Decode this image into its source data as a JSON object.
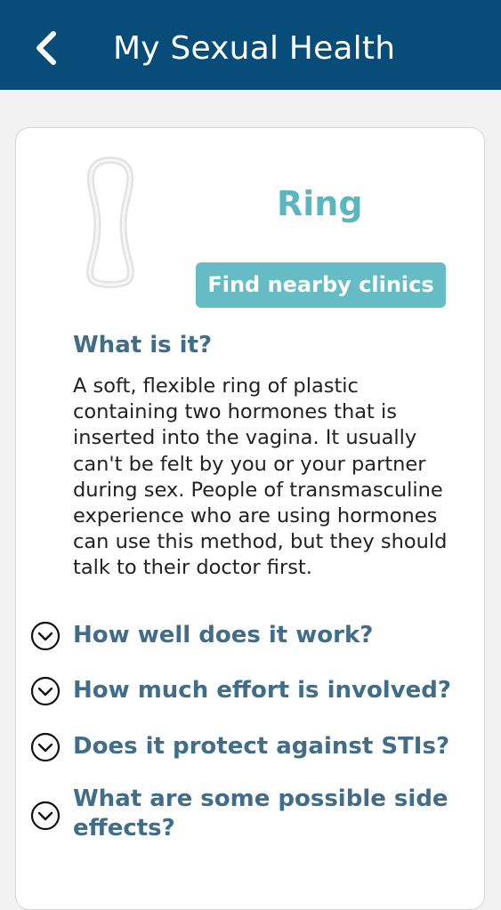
{
  "header": {
    "title": "My Sexual Health",
    "back_icon": "chevron-left-icon"
  },
  "colors": {
    "header_bg": "#084d7a",
    "accent_teal": "#5ab7bf",
    "heading_blue": "#3f6d8a"
  },
  "method": {
    "name": "Ring",
    "image_icon": "contraceptive-ring-image",
    "clinic_button_label": "Find nearby clinics"
  },
  "what_is_it": {
    "heading": "What is it?",
    "text": "A soft, flexible ring of plastic containing two hormones that is inserted into the vagina. It usually can't be felt by you or your partner during sex. People of transmasculine experience who are using hormones can use this method, but they should talk to their doctor first."
  },
  "accordion": {
    "expand_icon": "chevron-down-circle-icon",
    "items": [
      {
        "label": "How well does it work?"
      },
      {
        "label": "How much effort is involved?"
      },
      {
        "label": "Does it protect against STIs?"
      },
      {
        "label": "What are some possible side effects?"
      }
    ]
  }
}
